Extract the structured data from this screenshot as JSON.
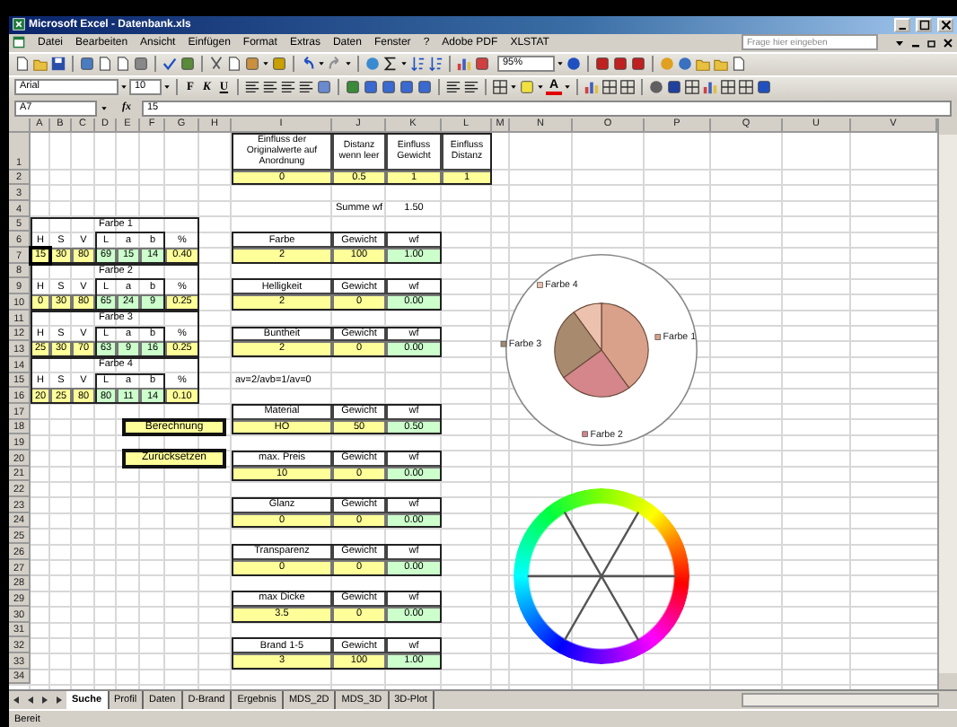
{
  "window": {
    "title": "Microsoft Excel - Datenbank.xls"
  },
  "menu": [
    "Datei",
    "Bearbeiten",
    "Ansicht",
    "Einfügen",
    "Format",
    "Extras",
    "Daten",
    "Fenster",
    "?",
    "Adobe PDF",
    "XLSTAT"
  ],
  "help_box": {
    "placeholder": "Frage hier eingeben"
  },
  "standard_toolbar": {
    "zoom": "95%"
  },
  "format_toolbar": {
    "font": "Arial",
    "size": "10",
    "bold": "F",
    "italic": "K",
    "underline": "U",
    "font_color": "A"
  },
  "formula_bar": {
    "name_box": "A7",
    "fx": "fx",
    "value": "15"
  },
  "sheet": {
    "columns": [
      "A",
      "B",
      "C",
      "D",
      "E",
      "F",
      "G",
      "H",
      "I",
      "J",
      "K",
      "L",
      "M",
      "N",
      "O",
      "P",
      "Q",
      "U",
      "V"
    ],
    "rows": [
      "1",
      "2",
      "3",
      "4",
      "5",
      "6",
      "7",
      "8",
      "9",
      "10",
      "11",
      "12",
      "13",
      "14",
      "15",
      "16",
      "17",
      "18",
      "19",
      "20",
      "21",
      "22",
      "23",
      "24",
      "25",
      "26",
      "27",
      "28",
      "29",
      "30",
      "31",
      "32",
      "33",
      "34"
    ],
    "settings": {
      "headers": [
        "Einfluss der Originalwerte auf Anordnung",
        "Distanz wenn leer",
        "Einfluss Gewicht",
        "Einfluss Distanz"
      ],
      "values": [
        "0",
        "0.5",
        "1",
        "1"
      ]
    },
    "sum": {
      "label": "Summe wf",
      "value": "1.50"
    },
    "color_blocks": [
      {
        "title": "Farbe 1",
        "headers": [
          "H",
          "S",
          "V",
          "L",
          "a",
          "b",
          "%"
        ],
        "hsv": [
          {
            "text": "15",
            "selected": true
          },
          {
            "text": "30",
            "selected": false
          },
          {
            "text": "80",
            "selected": false
          }
        ],
        "lab": [
          "69",
          "15",
          "14"
        ],
        "share": "0.40"
      },
      {
        "title": "Farbe 2",
        "headers": [
          "H",
          "S",
          "V",
          "L",
          "a",
          "b",
          "%"
        ],
        "hsv": [
          {
            "text": "0",
            "selected": false
          },
          {
            "text": "30",
            "selected": false
          },
          {
            "text": "80",
            "selected": false
          }
        ],
        "lab": [
          "65",
          "24",
          "9"
        ],
        "share": "0.25"
      },
      {
        "title": "Farbe 3",
        "headers": [
          "H",
          "S",
          "V",
          "L",
          "a",
          "b",
          "%"
        ],
        "hsv": [
          {
            "text": "25",
            "selected": false
          },
          {
            "text": "30",
            "selected": false
          },
          {
            "text": "70",
            "selected": false
          }
        ],
        "lab": [
          "63",
          "9",
          "16"
        ],
        "share": "0.25"
      },
      {
        "title": "Farbe 4",
        "headers": [
          "H",
          "S",
          "V",
          "L",
          "a",
          "b",
          "%"
        ],
        "hsv": [
          {
            "text": "20",
            "selected": false
          },
          {
            "text": "25",
            "selected": false
          },
          {
            "text": "80",
            "selected": false
          }
        ],
        "lab": [
          "80",
          "11",
          "14"
        ],
        "share": "0.10"
      }
    ],
    "note": "av=2/avb=1/av=0",
    "criteria": [
      {
        "label": "Farbe",
        "weight_label": "Gewicht",
        "wf_label": "wf",
        "value": "2",
        "weight": "100",
        "wf": "1.00"
      },
      {
        "label": "Helligkeit",
        "weight_label": "Gewicht",
        "wf_label": "wf",
        "value": "2",
        "weight": "0",
        "wf": "0.00"
      },
      {
        "label": "Buntheit",
        "weight_label": "Gewicht",
        "wf_label": "wf",
        "value": "2",
        "weight": "0",
        "wf": "0.00"
      },
      {
        "label": "Material",
        "weight_label": "Gewicht",
        "wf_label": "wf",
        "value": "HO",
        "weight": "50",
        "wf": "0.50"
      },
      {
        "label": "max. Preis",
        "weight_label": "Gewicht",
        "wf_label": "wf",
        "value": "10",
        "weight": "0",
        "wf": "0.00"
      },
      {
        "label": "Glanz",
        "weight_label": "Gewicht",
        "wf_label": "wf",
        "value": "0",
        "weight": "0",
        "wf": "0.00"
      },
      {
        "label": "Transparenz",
        "weight_label": "Gewicht",
        "wf_label": "wf",
        "value": "0",
        "weight": "0",
        "wf": "0.00"
      },
      {
        "label": "max Dicke",
        "weight_label": "Gewicht",
        "wf_label": "wf",
        "value": "3.5",
        "weight": "0",
        "wf": "0.00"
      },
      {
        "label": "Brand 1-5",
        "weight_label": "Gewicht",
        "wf_label": "wf",
        "value": "3",
        "weight": "100",
        "wf": "1.00"
      }
    ],
    "buttons": [
      "Berechnung",
      "Zurücksetzen"
    ],
    "chart_data": {
      "type": "pie",
      "categories": [
        "Farbe 1",
        "Farbe 2",
        "Farbe 3",
        "Farbe 4"
      ],
      "values": [
        0.4,
        0.25,
        0.25,
        0.1
      ],
      "legend": true
    }
  },
  "sheet_tabs": [
    {
      "label": "Suche",
      "selected": true
    },
    {
      "label": "Profil",
      "selected": false
    },
    {
      "label": "Daten",
      "selected": false
    },
    {
      "label": "D-Brand",
      "selected": false
    },
    {
      "label": "Ergebnis",
      "selected": false
    },
    {
      "label": "MDS_2D",
      "selected": false
    },
    {
      "label": "MDS_3D",
      "selected": false
    },
    {
      "label": "3D-Plot",
      "selected": false
    }
  ],
  "status_bar": {
    "text": "Bereit"
  }
}
